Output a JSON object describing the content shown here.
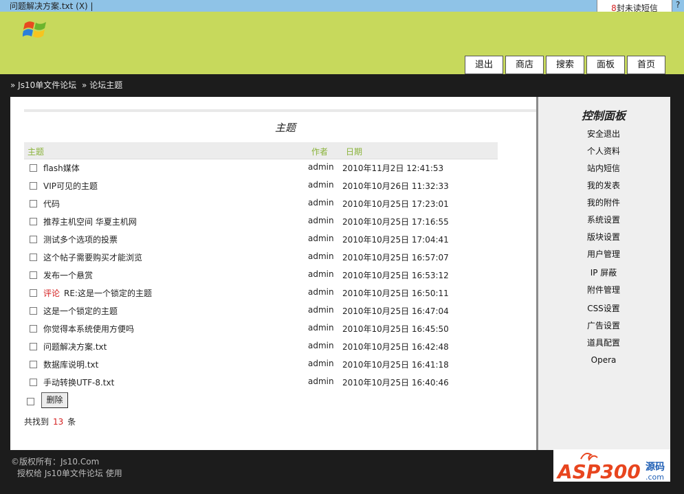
{
  "window": {
    "tab_title": "问题解决方案.txt (X) |",
    "help": "?",
    "sms": {
      "count": "8",
      "text": "封未读短信"
    }
  },
  "nav": [
    "退出",
    "商店",
    "搜索",
    "面板",
    "首页"
  ],
  "breadcrumb": [
    "» Js10单文件论坛",
    "» 论坛主题"
  ],
  "main": {
    "title": "主题",
    "headers": {
      "subject": "主题",
      "author": "作者",
      "date": "日期"
    },
    "rows": [
      {
        "prefix": "",
        "subject": "flash媒体",
        "author": "admin",
        "date": "2010年11月2日  12:41:53"
      },
      {
        "prefix": "",
        "subject": "VIP可见的主题",
        "author": "admin",
        "date": "2010年10月26日 11:32:33"
      },
      {
        "prefix": "",
        "subject": "代码",
        "author": "admin",
        "date": "2010年10月25日  17:23:01"
      },
      {
        "prefix": "",
        "subject": "推荐主机空间 华夏主机网",
        "author": "admin",
        "date": "2010年10月25日  17:16:55"
      },
      {
        "prefix": "",
        "subject": "测试多个选项的投票",
        "author": "admin",
        "date": "2010年10月25日  17:04:41"
      },
      {
        "prefix": "",
        "subject": "这个帖子需要购买才能浏览",
        "author": "admin",
        "date": "2010年10月25日  16:57:07"
      },
      {
        "prefix": "",
        "subject": "发布一个悬赏",
        "author": "admin",
        "date": "2010年10月25日  16:53:12"
      },
      {
        "prefix": "评论",
        "subject": "RE:这是一个锁定的主题",
        "author": "admin",
        "date": "2010年10月25日  16:50:11"
      },
      {
        "prefix": "",
        "subject": "这是一个锁定的主题",
        "author": "admin",
        "date": "2010年10月25日  16:47:04"
      },
      {
        "prefix": "",
        "subject": "你觉得本系统使用方便吗",
        "author": "admin",
        "date": "2010年10月25日  16:45:50"
      },
      {
        "prefix": "",
        "subject": "问题解决方案.txt",
        "author": "admin",
        "date": "2010年10月25日  16:42:48"
      },
      {
        "prefix": "",
        "subject": "数据库说明.txt",
        "author": "admin",
        "date": "2010年10月25日  16:41:18"
      },
      {
        "prefix": "",
        "subject": "手动转换UTF-8.txt",
        "author": "admin",
        "date": "2010年10月25日  16:40:46"
      }
    ],
    "delete_label": "删除",
    "found": {
      "prefix": "共找到",
      "count": "13",
      "suffix": "条"
    }
  },
  "sidebar": {
    "title": "控制面板",
    "items": [
      "安全退出",
      "个人资料",
      "站内短信",
      "我的发表",
      "我的附件",
      "系统设置",
      "版块设置",
      "用户管理",
      "IP  屏蔽",
      "附件管理",
      "CSS设置",
      "广告设置",
      "道具配置",
      "Opera"
    ]
  },
  "footer": {
    "copyright": "©版权所有：Js10.Com",
    "license": "授权给 Js10单文件论坛 使用"
  },
  "watermark": {
    "text": "ASP300",
    "suffix": "源码",
    "domain": ".com"
  },
  "colors": {
    "header": "#c7d95c",
    "topbar": "#8fc3e7",
    "accent_red": "#d42020",
    "column_header": "#8ab33a"
  }
}
